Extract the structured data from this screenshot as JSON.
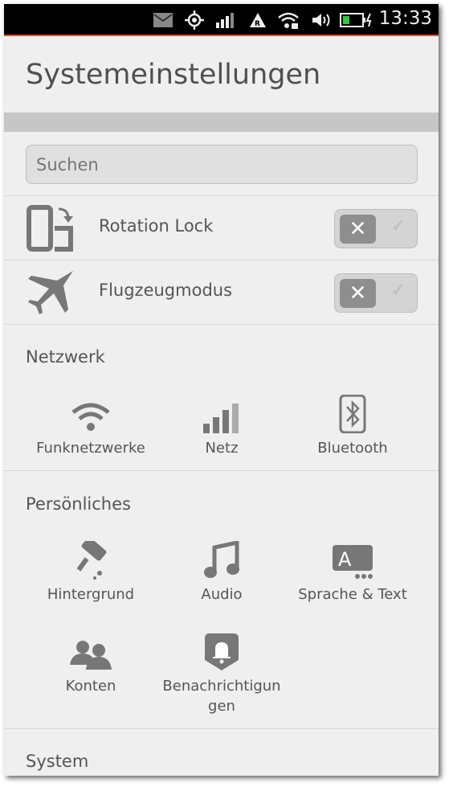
{
  "status": {
    "time": "13:33",
    "icons": [
      "mail-icon",
      "location-icon",
      "signal-icon",
      "roaming-icon",
      "wifi-locked-icon",
      "volume-icon",
      "battery-charging-icon"
    ]
  },
  "header": {
    "title": "Systemeinstellungen"
  },
  "search": {
    "placeholder": "Suchen",
    "value": ""
  },
  "toggles": [
    {
      "label": "Rotation Lock",
      "checked": false
    },
    {
      "label": "Flugzeugmodus",
      "checked": false
    }
  ],
  "toggle_glyphs": {
    "off": "✕",
    "on": "✓"
  },
  "sections": [
    {
      "title": "Netzwerk",
      "items": [
        {
          "label": "Funknetzwerke"
        },
        {
          "label": "Netz"
        },
        {
          "label": "Bluetooth"
        }
      ]
    },
    {
      "title": "Persönliches",
      "items": [
        {
          "label": "Hintergrund"
        },
        {
          "label": "Audio"
        },
        {
          "label": "Sprache & Text"
        },
        {
          "label": "Konten"
        },
        {
          "label": "Benachrichtigun gen"
        }
      ]
    },
    {
      "title": "System"
    }
  ],
  "colors": {
    "accent": "#d7532c",
    "icon": "#777777"
  }
}
